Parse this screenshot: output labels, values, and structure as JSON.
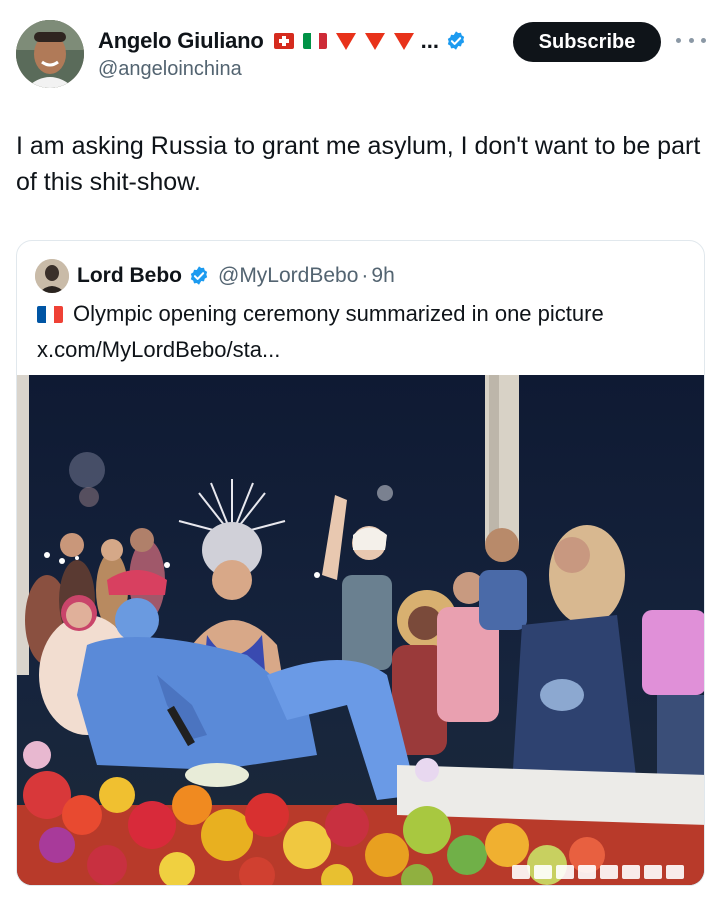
{
  "author": {
    "display_name": "Angelo Giuliano",
    "handle": "@angeloinchina",
    "name_suffix": "...",
    "flags": [
      "switzerland-flag",
      "italy-flag",
      "red-triangle",
      "red-triangle",
      "red-triangle"
    ],
    "verified_color": "#1d9bf0"
  },
  "actions": {
    "subscribe_label": "Subscribe"
  },
  "tweet": {
    "text": "I am asking Russia to grant me asylum, I don't want to be part of this shit-show."
  },
  "quoted": {
    "display_name": "Lord Bebo",
    "handle": "@MyLordBebo",
    "separator": "·",
    "time": "9h",
    "flag": "france-flag",
    "text": "Olympic opening ceremony summarized in one picture",
    "link": "x.com/MyLordBebo/sta..."
  },
  "colors": {
    "text_primary": "#0f1419",
    "text_secondary": "#536471",
    "button_bg": "#0f1419",
    "border": "#e1e8ed"
  }
}
